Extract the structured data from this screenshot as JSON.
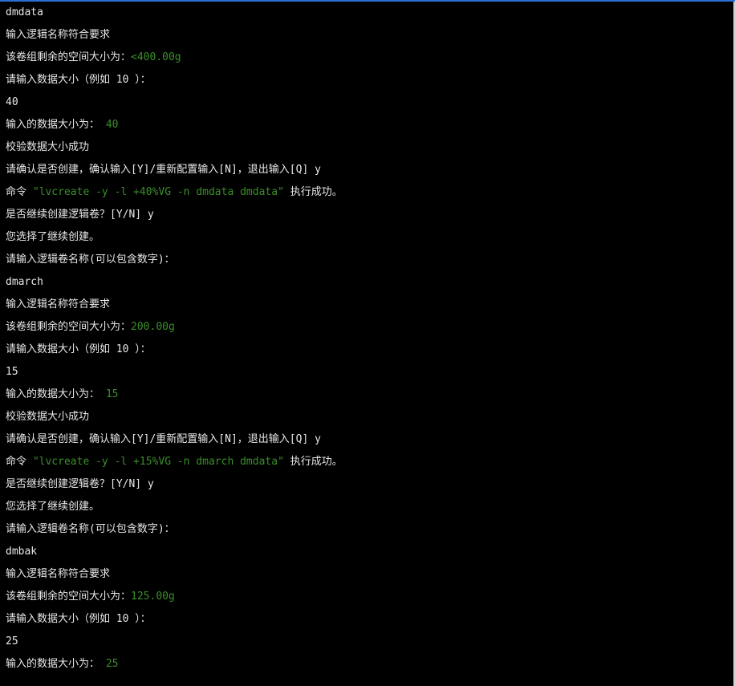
{
  "lines": [
    {
      "text": "dmdata"
    },
    {
      "text": "输入逻辑名称符合要求"
    },
    {
      "text": "该卷组剩余的空间大小为：",
      "value": "<400.00g"
    },
    {
      "text": "请输入数据大小（例如 10 ）："
    },
    {
      "text": "40"
    },
    {
      "text": "输入的数据大小为： ",
      "value": "40"
    },
    {
      "text": "校验数据大小成功"
    },
    {
      "text": "请确认是否创建，确认输入[Y]/重新配置输入[N]，退出输入[Q] y"
    },
    {
      "text": "命令 ",
      "value": "\"lvcreate -y -l +40%VG -n dmdata dmdata\"",
      "after": " 执行成功。"
    },
    {
      "text": "是否继续创建逻辑卷？[Y/N] y"
    },
    {
      "text": "您选择了继续创建。"
    },
    {
      "text": "请输入逻辑卷名称(可以包含数字)："
    },
    {
      "text": "dmarch"
    },
    {
      "text": "输入逻辑名称符合要求"
    },
    {
      "text": "该卷组剩余的空间大小为：",
      "value": "200.00g"
    },
    {
      "text": "请输入数据大小（例如 10 ）："
    },
    {
      "text": "15"
    },
    {
      "text": "输入的数据大小为： ",
      "value": "15"
    },
    {
      "text": "校验数据大小成功"
    },
    {
      "text": "请确认是否创建，确认输入[Y]/重新配置输入[N]，退出输入[Q] y"
    },
    {
      "text": "命令 ",
      "value": "\"lvcreate -y -l +15%VG -n dmarch dmdata\"",
      "after": " 执行成功。"
    },
    {
      "text": "是否继续创建逻辑卷？[Y/N] y"
    },
    {
      "text": "您选择了继续创建。"
    },
    {
      "text": "请输入逻辑卷名称(可以包含数字)："
    },
    {
      "text": "dmbak"
    },
    {
      "text": "输入逻辑名称符合要求"
    },
    {
      "text": "该卷组剩余的空间大小为：",
      "value": "125.00g"
    },
    {
      "text": "请输入数据大小（例如 10 ）："
    },
    {
      "text": "25"
    },
    {
      "text": "输入的数据大小为： ",
      "value": "25"
    }
  ],
  "colors": {
    "background": "#000000",
    "text": "#e8e8e8",
    "highlight": "#3a8f2a",
    "title_bar_accent": "#2a6fd6"
  }
}
